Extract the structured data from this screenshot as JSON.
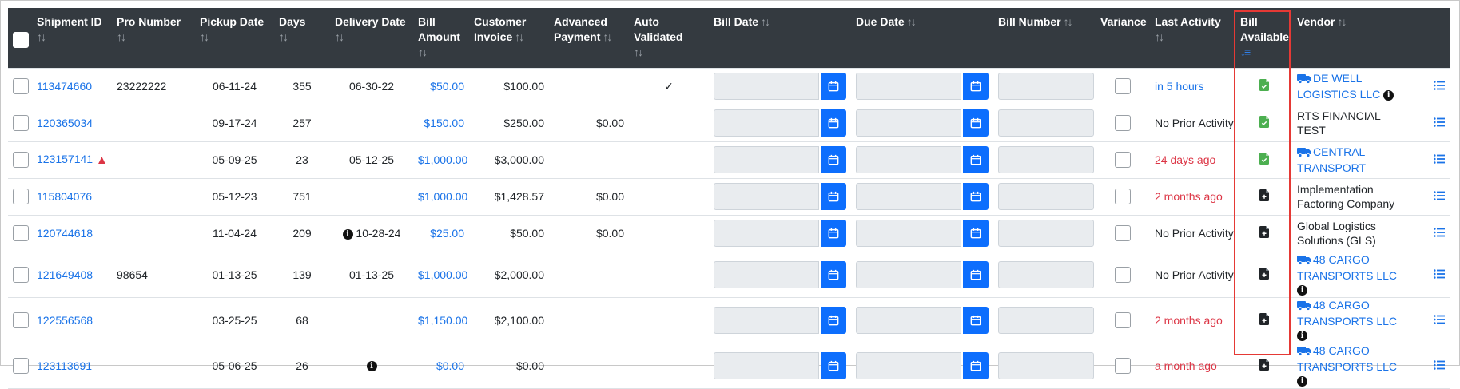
{
  "columns": {
    "shipment_id": "Shipment ID",
    "pro_number": "Pro Number",
    "pickup_date": "Pickup Date",
    "days": "Days",
    "delivery_date": "Delivery Date",
    "bill_amount_1": "Bill",
    "bill_amount_2": "Amount",
    "customer_invoice_1": "Customer",
    "customer_invoice_2": "Invoice",
    "advanced_payment_1": "Advanced",
    "advanced_payment_2": "Payment",
    "auto_validated_1": "Auto",
    "auto_validated_2": "Validated",
    "bill_date": "Bill Date",
    "due_date": "Due Date",
    "bill_number": "Bill Number",
    "variance": "Variance",
    "last_activity": "Last Activity",
    "bill_available_1": "Bill",
    "bill_available_2": "Available",
    "vendor": "Vendor"
  },
  "icons": {
    "sort": "sort-icon",
    "sort_active": "sort-desc-active-icon",
    "calendar": "calendar-icon",
    "truck": "truck-icon",
    "info": "info-icon",
    "warning": "warning-icon",
    "file_available": "file-green-icon",
    "file_add": "file-plus-icon",
    "list": "list-icon",
    "check": "check-icon"
  },
  "colors": {
    "header_bg": "#343a40",
    "link": "#1a73e8",
    "overdue_red": "#dc3545",
    "primary_button": "#0d6efd",
    "file_available_green": "#4caf50",
    "highlight_border": "#e53935"
  },
  "rows": [
    {
      "shipment_id": "113474660",
      "pro_number": "23222222",
      "pickup_date": "06-11-24",
      "days": "355",
      "delivery_date": "06-30-22",
      "bill_amount": "$50.00",
      "customer_invoice": "$100.00",
      "advanced_payment": "",
      "auto_validated": "✓",
      "last_activity": "in 5 hours",
      "activity_style": "link",
      "bill_available": "green",
      "vendor_1": "DE WELL",
      "vendor_2": "LOGISTICS LLC",
      "vendor_link": true,
      "vendor_info": true,
      "warning": false,
      "delivery_info": false
    },
    {
      "shipment_id": "120365034",
      "pro_number": "",
      "pickup_date": "09-17-24",
      "days": "257",
      "delivery_date": "",
      "bill_amount": "$150.00",
      "customer_invoice": "$250.00",
      "advanced_payment": "$0.00",
      "auto_validated": "",
      "last_activity": "No Prior Activity",
      "activity_style": "plain",
      "bill_available": "green",
      "vendor_1": "RTS FINANCIAL TEST",
      "vendor_2": "",
      "vendor_link": false,
      "vendor_info": false,
      "warning": false,
      "delivery_info": false
    },
    {
      "shipment_id": "123157141",
      "pro_number": "",
      "pickup_date": "05-09-25",
      "days": "23",
      "delivery_date": "05-12-25",
      "bill_amount": "$1,000.00",
      "customer_invoice": "$3,000.00",
      "advanced_payment": "",
      "auto_validated": "",
      "last_activity": "24 days ago",
      "activity_style": "red",
      "bill_available": "green",
      "vendor_1": "CENTRAL",
      "vendor_2": "TRANSPORT",
      "vendor_link": true,
      "vendor_info": false,
      "warning": true,
      "delivery_info": false
    },
    {
      "shipment_id": "115804076",
      "pro_number": "",
      "pickup_date": "05-12-23",
      "days": "751",
      "delivery_date": "",
      "bill_amount": "$1,000.00",
      "customer_invoice": "$1,428.57",
      "advanced_payment": "$0.00",
      "auto_validated": "",
      "last_activity": "2 months ago",
      "activity_style": "red",
      "bill_available": "add",
      "vendor_1": "Implementation",
      "vendor_2": "Factoring Company",
      "vendor_link": false,
      "vendor_info": false,
      "warning": false,
      "delivery_info": false
    },
    {
      "shipment_id": "120744618",
      "pro_number": "",
      "pickup_date": "11-04-24",
      "days": "209",
      "delivery_date": "10-28-24",
      "bill_amount": "$25.00",
      "customer_invoice": "$50.00",
      "advanced_payment": "$0.00",
      "auto_validated": "",
      "last_activity": "No Prior Activity",
      "activity_style": "plain",
      "bill_available": "add",
      "vendor_1": "Global Logistics",
      "vendor_2": "Solutions (GLS)",
      "vendor_link": false,
      "vendor_info": false,
      "warning": false,
      "delivery_info": true
    },
    {
      "shipment_id": "121649408",
      "pro_number": "98654",
      "pickup_date": "01-13-25",
      "days": "139",
      "delivery_date": "01-13-25",
      "bill_amount": "$1,000.00",
      "customer_invoice": "$2,000.00",
      "advanced_payment": "",
      "auto_validated": "",
      "last_activity": "No Prior Activity",
      "activity_style": "plain",
      "bill_available": "add",
      "vendor_1": "48 CARGO",
      "vendor_2": "TRANSPORTS LLC",
      "vendor_link": true,
      "vendor_info": true,
      "warning": false,
      "delivery_info": false
    },
    {
      "shipment_id": "122556568",
      "pro_number": "",
      "pickup_date": "03-25-25",
      "days": "68",
      "delivery_date": "",
      "bill_amount": "$1,150.00",
      "customer_invoice": "$2,100.00",
      "advanced_payment": "",
      "auto_validated": "",
      "last_activity": "2 months ago",
      "activity_style": "red",
      "bill_available": "add",
      "vendor_1": "48 CARGO",
      "vendor_2": "TRANSPORTS LLC",
      "vendor_link": true,
      "vendor_info": true,
      "warning": false,
      "delivery_info": false
    },
    {
      "shipment_id": "123113691",
      "pro_number": "",
      "pickup_date": "05-06-25",
      "days": "26",
      "delivery_date": "",
      "bill_amount": "$0.00",
      "customer_invoice": "$0.00",
      "advanced_payment": "",
      "auto_validated": "",
      "last_activity": "a month ago",
      "activity_style": "red",
      "bill_available": "add",
      "vendor_1": "48 CARGO",
      "vendor_2": "TRANSPORTS LLC",
      "vendor_link": true,
      "vendor_info": true,
      "warning": false,
      "delivery_info": true
    }
  ]
}
